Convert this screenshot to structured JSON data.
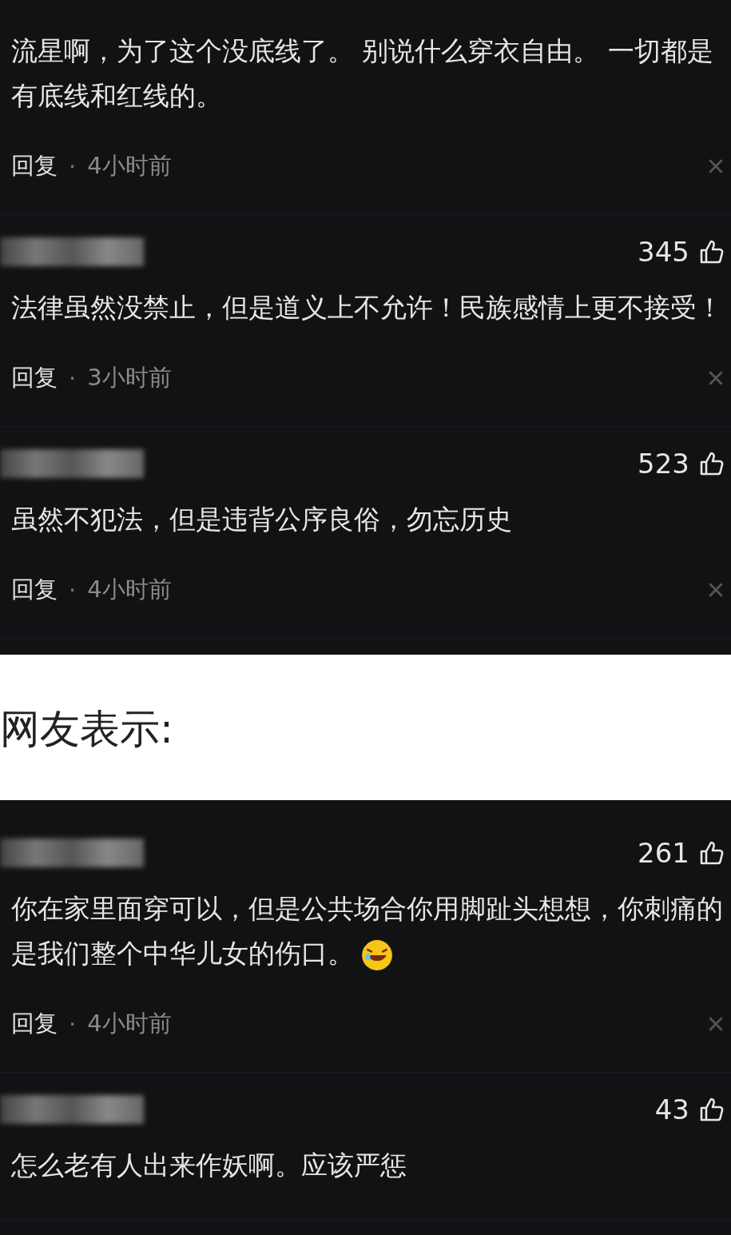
{
  "sections": [
    {
      "kind": "screenshot",
      "comments": [
        {
          "text": "流星啊，为了这个没底线了。 别说什么穿衣自由。 一切都是有底线和红线的。",
          "reply": "回复",
          "separator": "·",
          "time": "4小时前"
        },
        {
          "username_blurred": true,
          "likes": "345",
          "text": "法律虽然没禁止，但是道义上不允许！民族感情上更不接受！",
          "reply": "回复",
          "separator": "·",
          "time": "3小时前"
        },
        {
          "username_blurred": true,
          "likes": "523",
          "text": "虽然不犯法，但是违背公序良俗，勿忘历史",
          "reply": "回复",
          "separator": "·",
          "time": "4小时前"
        }
      ]
    },
    {
      "kind": "caption",
      "text": "网友表示:"
    },
    {
      "kind": "screenshot",
      "comments": [
        {
          "username_blurred": true,
          "likes": "261",
          "text": "你在家里面穿可以，但是公共场合你用脚趾头想想，你刺痛的是我们整个中华儿女的伤口。",
          "has_emoji": true,
          "reply": "回复",
          "separator": "·",
          "time": "4小时前"
        },
        {
          "username_blurred": true,
          "likes": "43",
          "text": "怎么老有人出来作妖啊。应该严惩"
        }
      ]
    }
  ]
}
